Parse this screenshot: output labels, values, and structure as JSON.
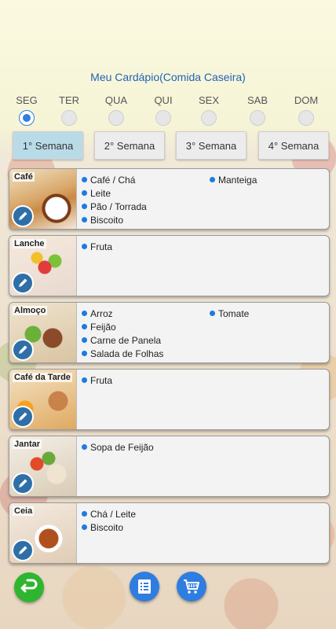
{
  "header": {
    "title": "Meu Cardápio(Comida Caseira)"
  },
  "days": [
    {
      "label": "SEG",
      "selected": true
    },
    {
      "label": "TER",
      "selected": false
    },
    {
      "label": "QUA",
      "selected": false
    },
    {
      "label": "QUI",
      "selected": false
    },
    {
      "label": "SEX",
      "selected": false
    },
    {
      "label": "SAB",
      "selected": false
    },
    {
      "label": "DOM",
      "selected": false
    }
  ],
  "weeks": [
    {
      "label": "1° Semana",
      "active": true
    },
    {
      "label": "2° Semana",
      "active": false
    },
    {
      "label": "3° Semana",
      "active": false
    },
    {
      "label": "4° Semana",
      "active": false
    }
  ],
  "meals": [
    {
      "name": "Café",
      "col1": [
        "Café / Chá",
        "Leite",
        "Pão / Torrada",
        "Biscoito"
      ],
      "col2": [
        "Manteiga"
      ]
    },
    {
      "name": "Lanche",
      "col1": [
        "Fruta"
      ],
      "col2": []
    },
    {
      "name": "Almoço",
      "col1": [
        "Arroz",
        "Feijão",
        "Carne de Panela",
        "Salada de Folhas"
      ],
      "col2": [
        "Tomate"
      ]
    },
    {
      "name": "Café da Tarde",
      "col1": [
        "Fruta"
      ],
      "col2": []
    },
    {
      "name": "Jantar",
      "col1": [
        "Sopa de Feijão"
      ],
      "col2": []
    },
    {
      "name": "Ceia",
      "col1": [
        "Chá / Leite",
        "Biscoito"
      ],
      "col2": []
    }
  ],
  "bottom_bar": {
    "back_icon": "back-arrow-icon",
    "list_icon": "list-icon",
    "cart_icon": "shopping-cart-icon"
  },
  "colors": {
    "accent": "#1f63b6",
    "dot": "#1e7be0",
    "week_active": "#b9dbe8",
    "back_button": "#2fb52f",
    "list_button": "#2f7de0"
  }
}
